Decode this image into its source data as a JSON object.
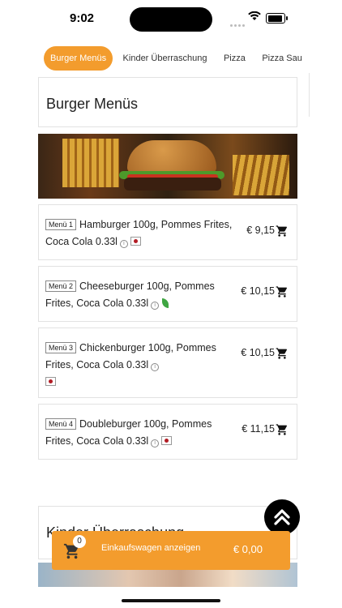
{
  "status_bar": {
    "time": "9:02"
  },
  "tabs": [
    {
      "label": "Burger Menüs",
      "active": true
    },
    {
      "label": "Kinder Überraschung",
      "active": false
    },
    {
      "label": "Pizza",
      "active": false
    },
    {
      "label": "Pizza Sau",
      "active": false
    }
  ],
  "sections": [
    {
      "title": "Burger Menüs",
      "items": [
        {
          "badge": "Menü 1",
          "name": "Hamburger 100g, Pommes Frites, Coca Cola 0.33l",
          "price": "€ 9,15",
          "tags": [
            "info-icon",
            "allergen-flag-icon"
          ]
        },
        {
          "badge": "Menü 2",
          "name": "Cheeseburger 100g, Pommes Frites, Coca Cola 0.33l",
          "price": "€ 10,15",
          "tags": [
            "info-icon",
            "vegetarian-leaf-icon"
          ]
        },
        {
          "badge": "Menü 3",
          "name": "Chickenburger 100g, Pommes Frites, Coca Cola 0.33l",
          "price": "€ 10,15",
          "tags": [
            "info-icon",
            "allergen-flag-icon"
          ]
        },
        {
          "badge": "Menü 4",
          "name": "Doubleburger 100g, Pommes Frites, Coca Cola 0.33l",
          "price": "€ 11,15",
          "tags": [
            "info-icon",
            "allergen-flag-icon"
          ]
        }
      ]
    },
    {
      "title": "Kinder Überraschung"
    }
  ],
  "cart_bar": {
    "count": "0",
    "label": "Einkaufswagen anzeigen",
    "total": "€ 0,00"
  },
  "colors": {
    "accent": "#f39c2d",
    "fab": "#000000"
  }
}
